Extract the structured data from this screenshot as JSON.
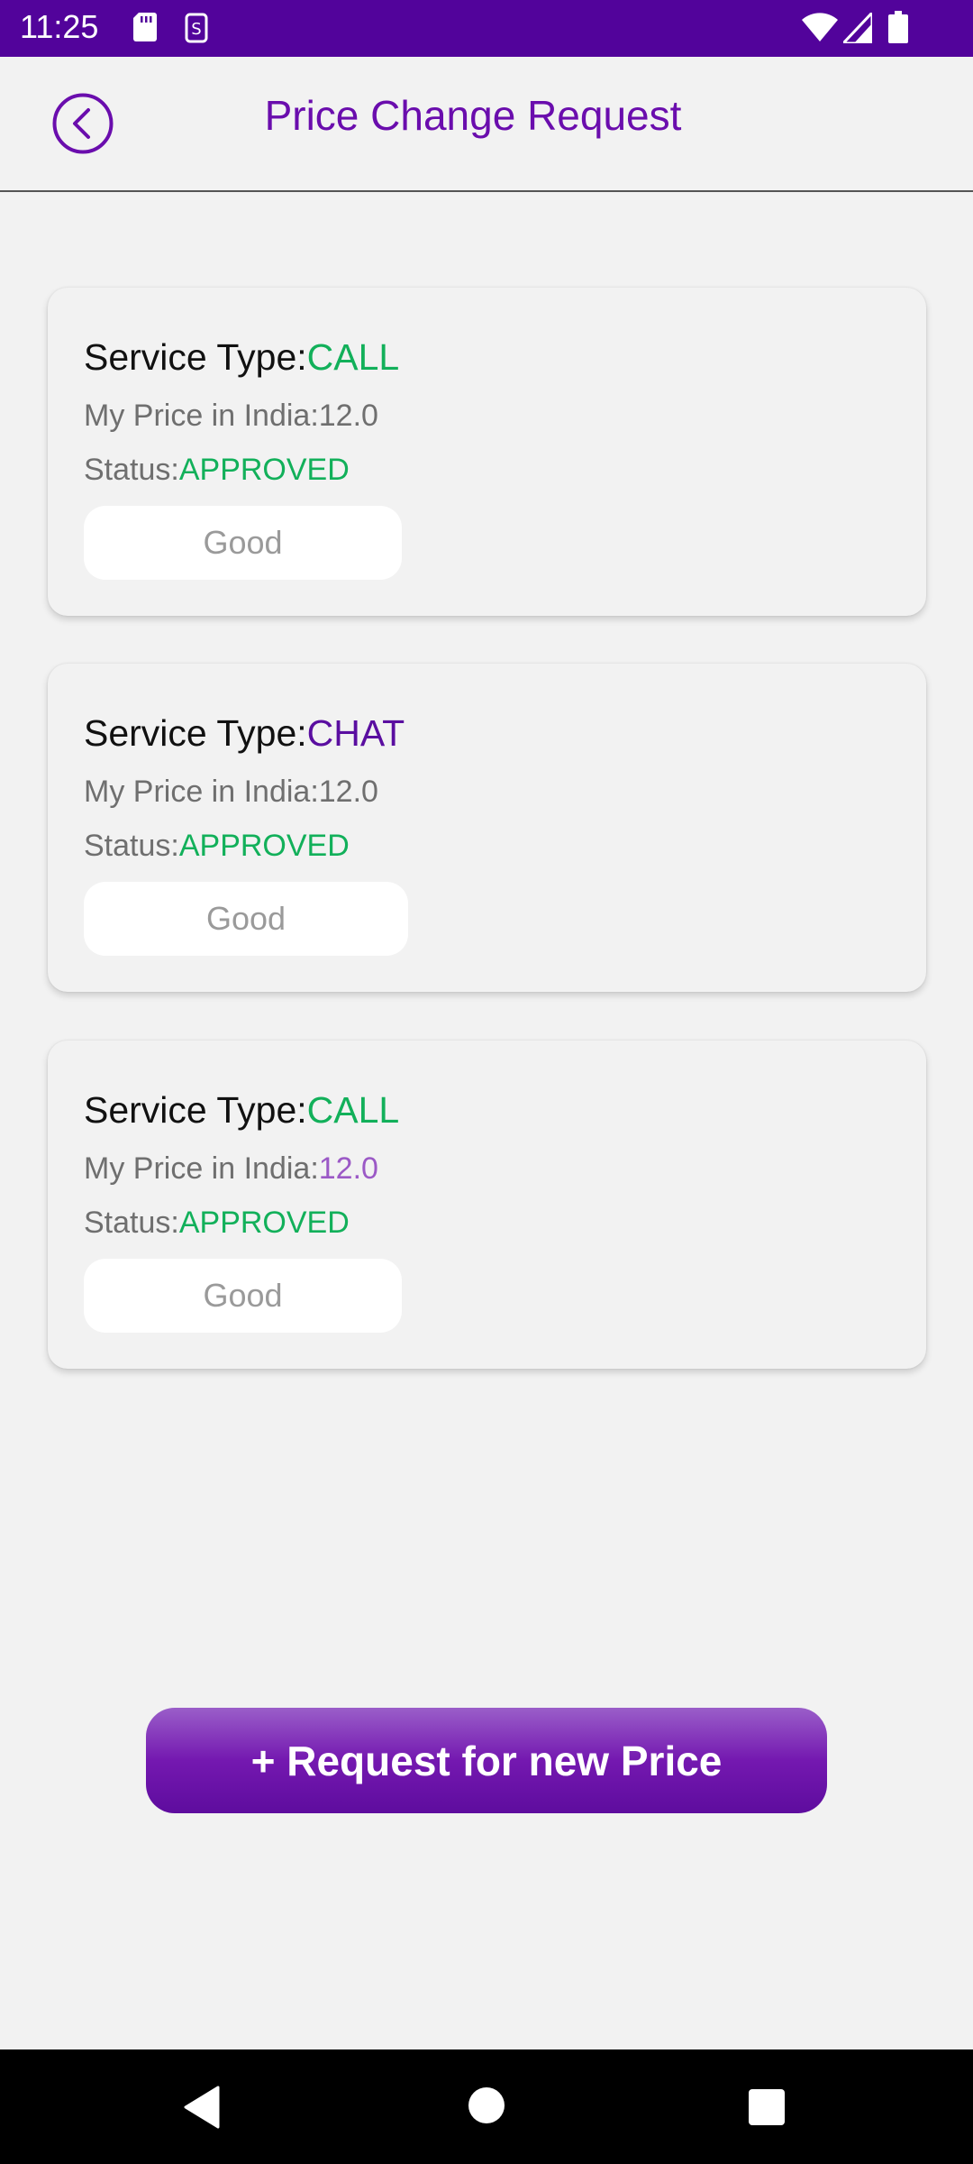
{
  "status_bar": {
    "time": "11:25",
    "icons": [
      "sd-card-icon",
      "vpn-icon",
      "wifi-icon",
      "signal-icon",
      "battery-icon"
    ],
    "background": "#52039b"
  },
  "header": {
    "title": "Price Change Request",
    "back_icon": "back-circle-icon",
    "accent": "#6a0dad"
  },
  "cards": [
    {
      "service_label": "Service Type:",
      "service_value": "CALL",
      "price_label": "My Price in India:",
      "price_value": "12.0",
      "status_label": "Status:",
      "status_value": "APPROVED",
      "feedback": "Good"
    },
    {
      "service_label": "Service Type:",
      "service_value": "CHAT",
      "price_label": "My Price in India:",
      "price_value": "12.0",
      "status_label": "Status:",
      "status_value": "APPROVED",
      "feedback": "Good"
    },
    {
      "service_label": "Service Type:",
      "service_value": "CALL",
      "price_label": "My Price in India:",
      "price_value": "12.0",
      "status_label": "Status:",
      "status_value": "APPROVED",
      "feedback": "Good"
    }
  ],
  "colors": {
    "call": "#12b05a",
    "chat": "#5a0ea0",
    "approved": "#12b05a"
  },
  "request_button": {
    "label": "+ Request for new Price"
  },
  "nav_bar": {
    "icons": [
      "nav-back-icon",
      "nav-home-icon",
      "nav-recents-icon"
    ]
  }
}
